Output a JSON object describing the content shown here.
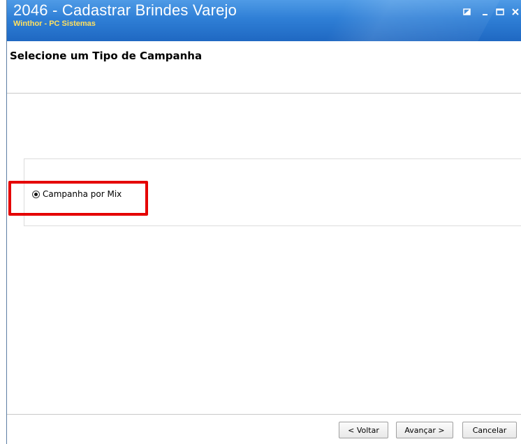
{
  "window": {
    "title": "2046 - Cadastrar Brindes Varejo",
    "subtitle": "Winthor - PC Sistemas"
  },
  "header": {
    "title": "Selecione um Tipo de Campanha"
  },
  "options": {
    "campaign_mix": {
      "label": "Campanha por Mix",
      "selected": true
    }
  },
  "footer": {
    "back_label": "< Voltar",
    "next_label": "Avançar >",
    "cancel_label": "Cancelar"
  },
  "colors": {
    "titlebar": "#2f7fd6",
    "subtitle": "#ffe060",
    "highlight": "#e50000"
  },
  "icons": [
    "restore-icon",
    "minimize-icon",
    "maximize-icon",
    "close-icon",
    "radio-selected-icon"
  ]
}
